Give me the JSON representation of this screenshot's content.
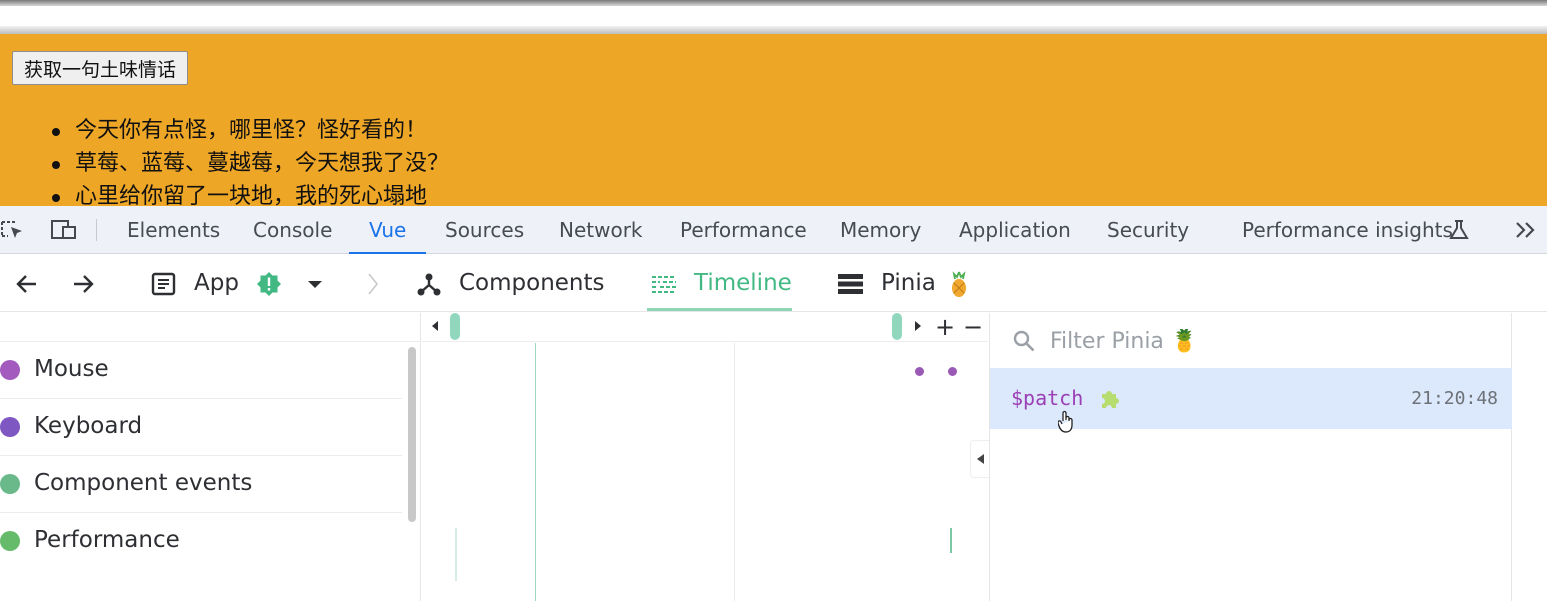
{
  "page": {
    "button_label": "获取一句土味情话",
    "list_items": [
      "今天你有点怪，哪里怪？怪好看的！",
      "草莓、蓝莓、蔓越莓，今天想我了没？",
      "心里给你留了一块地，我的死心塌地"
    ],
    "background_color": "#eea626"
  },
  "devtools": {
    "tabs": [
      "Elements",
      "Console",
      "Vue",
      "Sources",
      "Network",
      "Performance",
      "Memory",
      "Application",
      "Security",
      "Performance insights"
    ],
    "active_tab": "Vue",
    "icons": [
      "inspect-element-icon",
      "device-toolbar-icon",
      "flask-icon",
      "more-tabs-icon"
    ]
  },
  "vue_toolbar": {
    "app_label": "App",
    "components_label": "Components",
    "timeline_label": "Timeline",
    "pinia_label": "Pinia",
    "active": "Timeline",
    "accent_color": "#42b983"
  },
  "layers": [
    {
      "label": "Mouse",
      "color": "#a35bbd"
    },
    {
      "label": "Keyboard",
      "color": "#7e57c2"
    },
    {
      "label": "Component events",
      "color": "#69b98b"
    },
    {
      "label": "Performance",
      "color": "#66bb6a"
    }
  ],
  "timeline": {
    "zoom_in": "+",
    "zoom_out": "−"
  },
  "events_panel": {
    "filter_placeholder": "Filter Pinia 🍍",
    "events": [
      {
        "name": "$patch",
        "time": "21:20:48",
        "selected": true
      }
    ]
  }
}
